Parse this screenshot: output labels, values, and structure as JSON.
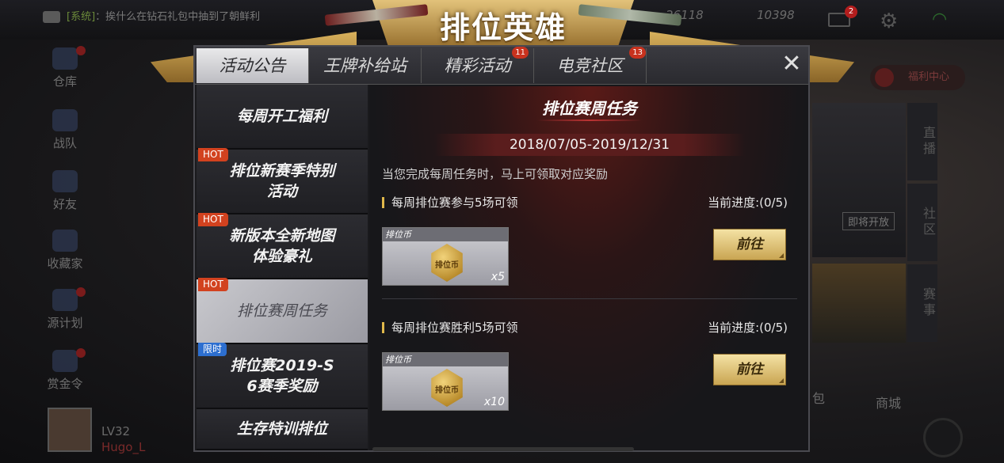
{
  "background": {
    "system_tag": "[系统]",
    "system_message": "：挨什么在钻石礼包中抽到了朝鲜利",
    "top_right_value_1": "26118",
    "top_right_value_2": "10398",
    "mail_badge": "2",
    "left_nav": [
      {
        "label": "仓库"
      },
      {
        "label": "战队"
      },
      {
        "label": "好友"
      },
      {
        "label": "收藏家"
      },
      {
        "label": "源计划"
      },
      {
        "label": "赏金令"
      }
    ],
    "player": {
      "level": "LV32",
      "name": "Hugo_L"
    },
    "welfare_label": "福利中心",
    "right_tabs": [
      "直播",
      "社区",
      "赛事"
    ],
    "promo_button": "即将开放",
    "shop_label": "商城",
    "bag_label": "包"
  },
  "banner": {
    "title": "排位英雄"
  },
  "panel": {
    "tabs": [
      {
        "label": "活动公告",
        "badge": ""
      },
      {
        "label": "王牌补给站",
        "badge": ""
      },
      {
        "label": "精彩活动",
        "badge": "11"
      },
      {
        "label": "电竞社区",
        "badge": "13"
      }
    ],
    "close_symbol": "✕",
    "sidebar": [
      {
        "label": "每周开工福利",
        "tag": ""
      },
      {
        "label": "排位新赛季特别\n活动",
        "tag": "HOT"
      },
      {
        "label": "新版本全新地图\n体验豪礼",
        "tag": "HOT"
      },
      {
        "label": "排位赛周任务",
        "tag": "HOT"
      },
      {
        "label": "排位赛2019-S\n6赛季奖励",
        "tag": "限时"
      },
      {
        "label": "生存特训排位",
        "tag": ""
      }
    ],
    "content": {
      "title": "排位赛周任务",
      "date_range": "2018/07/05-2019/12/31",
      "description": "当您完成每周任务时，马上可领取对应奖励",
      "tasks": [
        {
          "name": "每周排位赛参与5场可领",
          "progress": "当前进度:(0/5)",
          "reward_name": "排位币",
          "coin_label": "排位币",
          "quantity": "x5",
          "button": "前往"
        },
        {
          "name": "每周排位赛胜利5场可领",
          "progress": "当前进度:(0/5)",
          "reward_name": "排位币",
          "coin_label": "排位币",
          "quantity": "x10",
          "button": "前往"
        }
      ]
    }
  },
  "colors": {
    "hot_tag": "#d2421f",
    "limited_tag": "#2d6fd0",
    "badge": "#c8321e",
    "gold_button": "#e3c67a",
    "accent_bar": "#e0b84a"
  }
}
